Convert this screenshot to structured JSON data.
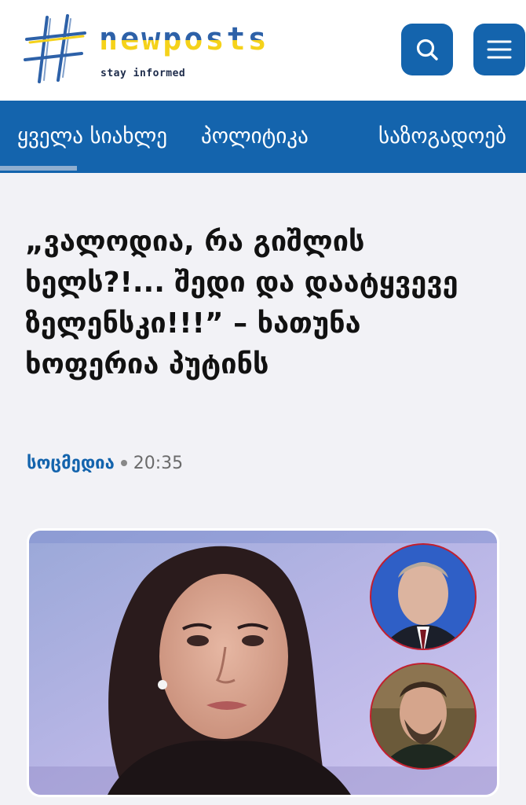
{
  "brand": {
    "name": "newposts",
    "tagline": "stay informed",
    "colors": {
      "blue": "#1464ad",
      "yellow": "#f5d21a"
    }
  },
  "header": {
    "search_icon": "search-icon",
    "menu_icon": "hamburger-menu-icon"
  },
  "nav": {
    "items": [
      {
        "label": "ყველა სიახლე",
        "active": true
      },
      {
        "label": "პოლიტიკა"
      },
      {
        "label": "საზოგადოებ"
      }
    ]
  },
  "article": {
    "headline": "„ვალოდია, რა გიშლის ხელს?!... შედი და დაატყვევე ზელენსკი!!!” – ხათუნა ხოფერია პუტინს",
    "source": "სოცმედია",
    "time": "20:35"
  }
}
